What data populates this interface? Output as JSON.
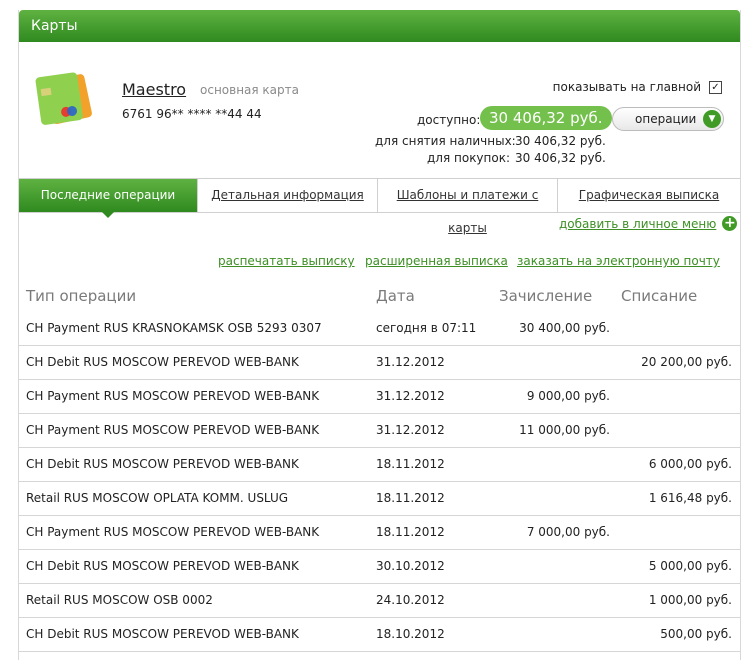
{
  "header": {
    "title": "Карты"
  },
  "card": {
    "name": "Maestro",
    "type": "основная карта",
    "number": "6761 96** **** **44 44",
    "show_on_main_label": "показывать на главной",
    "show_on_main_checked": "✓"
  },
  "balance": {
    "available_label": "доступно:",
    "available_value": "30 406,32 руб.",
    "operations_button": "операции",
    "cash_label": "для снятия наличных:",
    "cash_value": "30 406,32 руб.",
    "purchase_label": "для покупок:",
    "purchase_value": "30 406,32 руб."
  },
  "tabs": [
    {
      "label": "Последние операции",
      "active": true
    },
    {
      "label": "Детальная информация",
      "active": false
    },
    {
      "label": "Шаблоны и платежи с карты",
      "active": false
    },
    {
      "label": "Графическая выписка",
      "active": false
    }
  ],
  "add_menu": "добавить в личное меню",
  "links": {
    "print": "распечатать выписку",
    "extended": "расширенная выписка",
    "email": "заказать на электронную почту"
  },
  "table": {
    "headers": [
      "Тип операции",
      "Дата",
      "Зачисление",
      "Списание"
    ],
    "rows": [
      [
        "CH Payment RUS KRASNOKAMSK OSB 5293 0307",
        "сегодня в 07:11",
        "30 400,00 руб.",
        ""
      ],
      [
        "CH Debit RUS MOSCOW PEREVOD WEB-BANK",
        "31.12.2012",
        "",
        "20 200,00 руб."
      ],
      [
        "CH Payment RUS MOSCOW PEREVOD WEB-BANK",
        "31.12.2012",
        "9 000,00 руб.",
        ""
      ],
      [
        "CH Payment RUS MOSCOW PEREVOD WEB-BANK",
        "31.12.2012",
        "11 000,00 руб.",
        ""
      ],
      [
        "CH Debit RUS MOSCOW PEREVOD WEB-BANK",
        "18.11.2012",
        "",
        "6 000,00 руб."
      ],
      [
        "Retail RUS MOSCOW OPLATA KOMM. USLUG",
        "18.11.2012",
        "",
        "1 616,48 руб."
      ],
      [
        "CH Payment RUS MOSCOW PEREVOD WEB-BANK",
        "18.11.2012",
        "7 000,00 руб.",
        ""
      ],
      [
        "CH Debit RUS MOSCOW PEREVOD WEB-BANK",
        "30.10.2012",
        "",
        "5 000,00 руб."
      ],
      [
        "Retail RUS MOSCOW OSB 0002",
        "24.10.2012",
        "",
        "1 000,00 руб."
      ],
      [
        "CH Debit RUS MOSCOW PEREVOD WEB-BANK",
        "18.10.2012",
        "",
        "500,00 руб."
      ]
    ]
  },
  "colors": {
    "accent_green": "#3f9b25",
    "link_green": "#3d8f25",
    "header_grey": "#7a7a7a"
  }
}
